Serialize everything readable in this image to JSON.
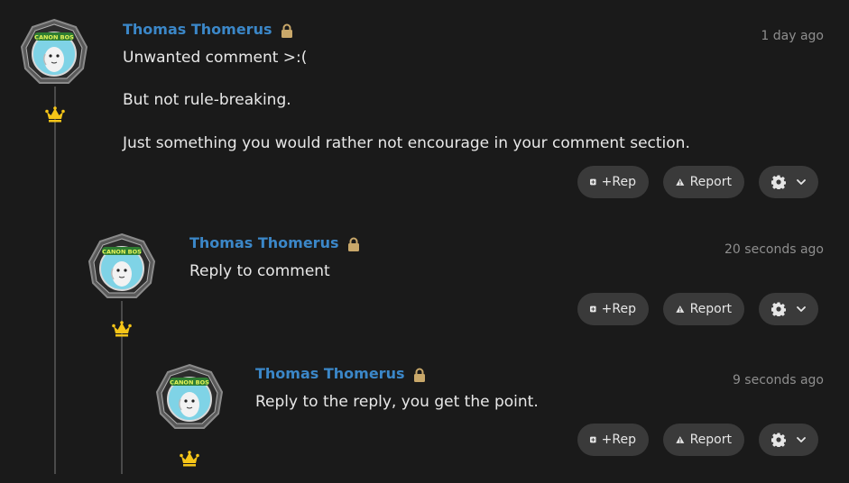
{
  "colors": {
    "background": "#1a1a1a",
    "author": "#3b87c8",
    "crown": "#f5c518",
    "lock": "#c9a86a",
    "button_bg": "#3a3a3a",
    "timestamp": "#8e8e8e"
  },
  "actions": {
    "rep_label": "+Rep",
    "report_label": "Report",
    "rep_icon": "plus-square-icon",
    "report_icon": "warning-triangle-icon",
    "settings_icon": "gear-icon",
    "dropdown_icon": "chevron-down-icon"
  },
  "avatar_badge_text": "CANON BOS",
  "comments": [
    {
      "author": "Thomas Thomerus",
      "timestamp": "1 day ago",
      "paragraphs": [
        "Unwanted comment >:(",
        "But not rule-breaking.",
        "Just something you would rather not encourage in your comment section."
      ]
    },
    {
      "author": "Thomas Thomerus",
      "timestamp": "20 seconds ago",
      "paragraphs": [
        "Reply to comment"
      ]
    },
    {
      "author": "Thomas Thomerus",
      "timestamp": "9 seconds ago",
      "paragraphs": [
        "Reply to the reply, you get the point."
      ]
    }
  ]
}
